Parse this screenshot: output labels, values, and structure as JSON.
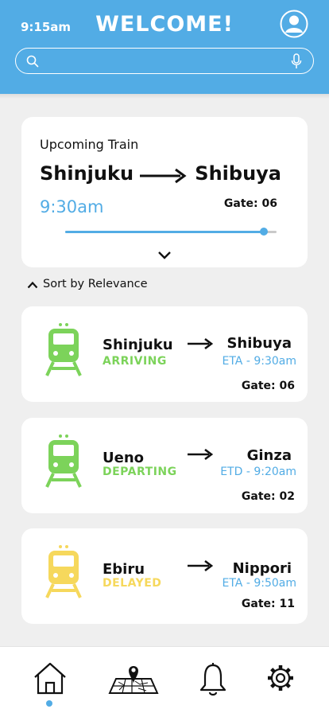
{
  "status_bar": {
    "time": "9:15am"
  },
  "header": {
    "title": "WELCOME!",
    "avatar_icon": "user-circle-icon"
  },
  "search": {
    "value": "",
    "placeholder": "",
    "search_icon": "search-icon",
    "mic_icon": "microphone-icon"
  },
  "upcoming": {
    "label": "Upcoming Train",
    "from": "Shinjuku",
    "to": "Shibuya",
    "time": "9:30am",
    "gate": "Gate: 06",
    "progress": 0.94
  },
  "sort": {
    "label": "Sort by Relevance"
  },
  "trains": [
    {
      "from": "Shinjuku",
      "status": "ARRIVING",
      "status_color": "#7cd35a",
      "to": "Shibuya",
      "eta": "ETA - 9:30am",
      "gate": "Gate: 06"
    },
    {
      "from": "Ueno",
      "status": "DEPARTING",
      "status_color": "#7cd35a",
      "to": "Ginza",
      "eta": "ETD - 9:20am",
      "gate": "Gate: 02"
    },
    {
      "from": "Ebiru",
      "status": "DELAYED",
      "status_color": "#f6d85c",
      "to": "Nippori",
      "eta": "ETA - 9:50am",
      "gate": "Gate: 11"
    }
  ],
  "nav": {
    "items": [
      "home-icon",
      "map-icon",
      "bell-icon",
      "gear-icon"
    ],
    "active": "home"
  },
  "colors": {
    "accent": "#52ace5",
    "green": "#7cd35a",
    "yellow": "#f6d85c"
  }
}
